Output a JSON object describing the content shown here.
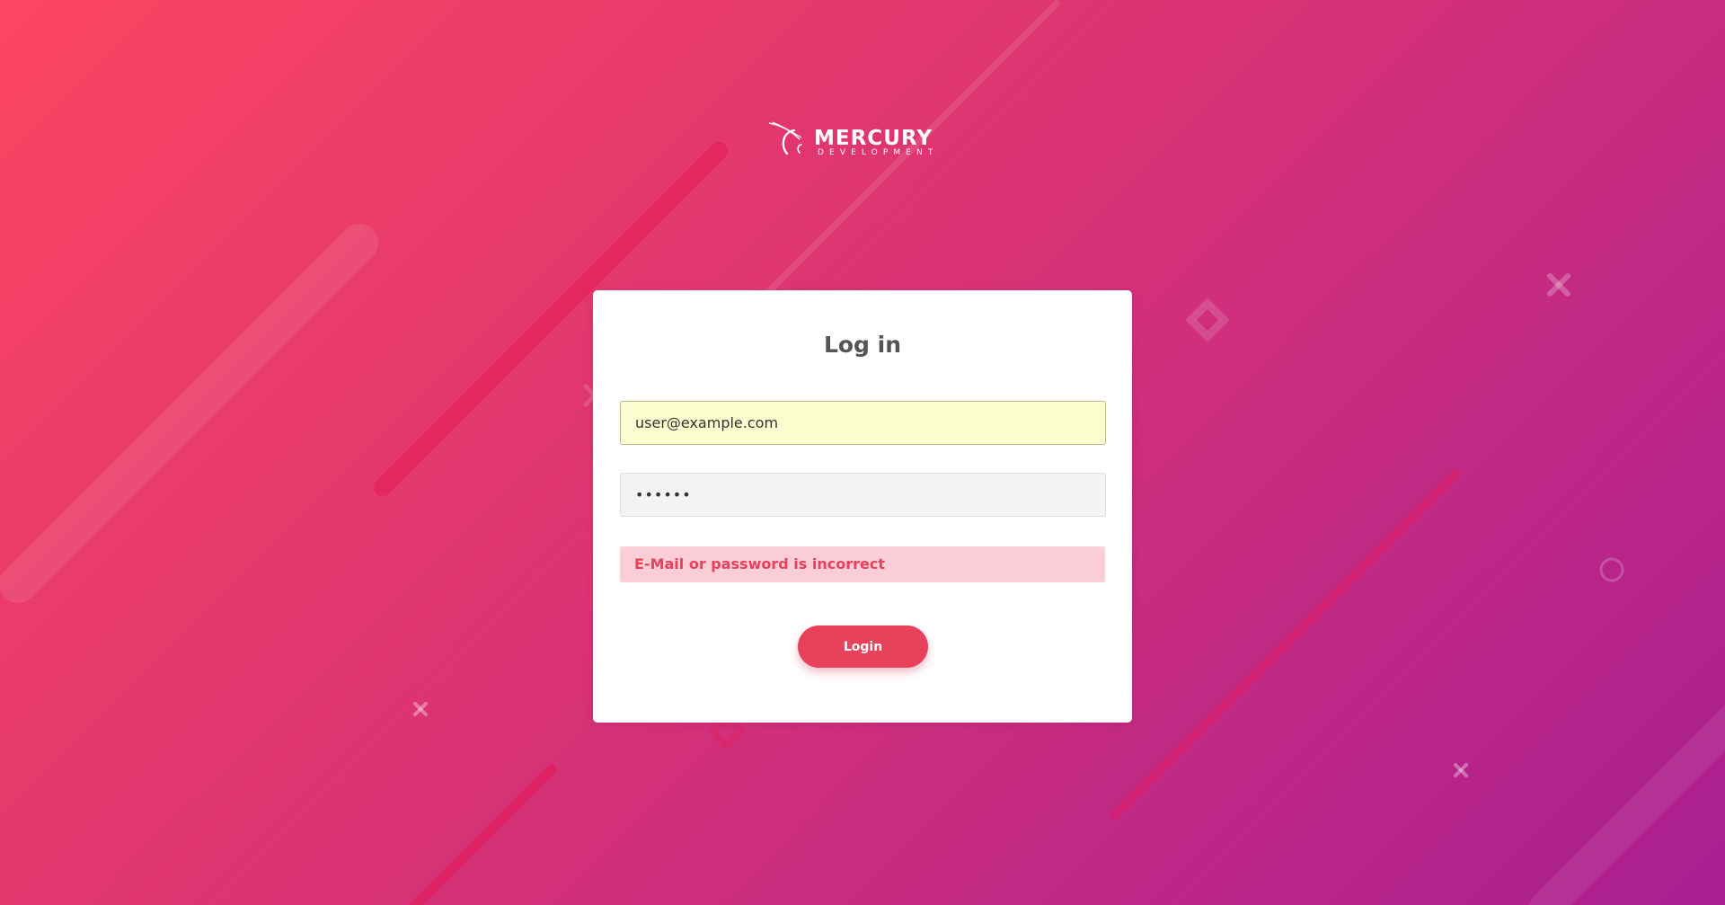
{
  "logo": {
    "wordmark": "MERCURY",
    "subtitle": "DEVELOPMENT"
  },
  "login_card": {
    "title": "Log in",
    "email_value": "user@example.com",
    "password_value": "••••••",
    "error_message": "E-Mail or password is incorrect",
    "login_button_label": "Login"
  },
  "colors": {
    "background_start": "#fb4661",
    "background_end": "#a91f92",
    "button": "#e8415a",
    "error_text": "#e8415d",
    "error_background": "#fbcdd6",
    "email_autofill_background": "#fbffd0"
  }
}
